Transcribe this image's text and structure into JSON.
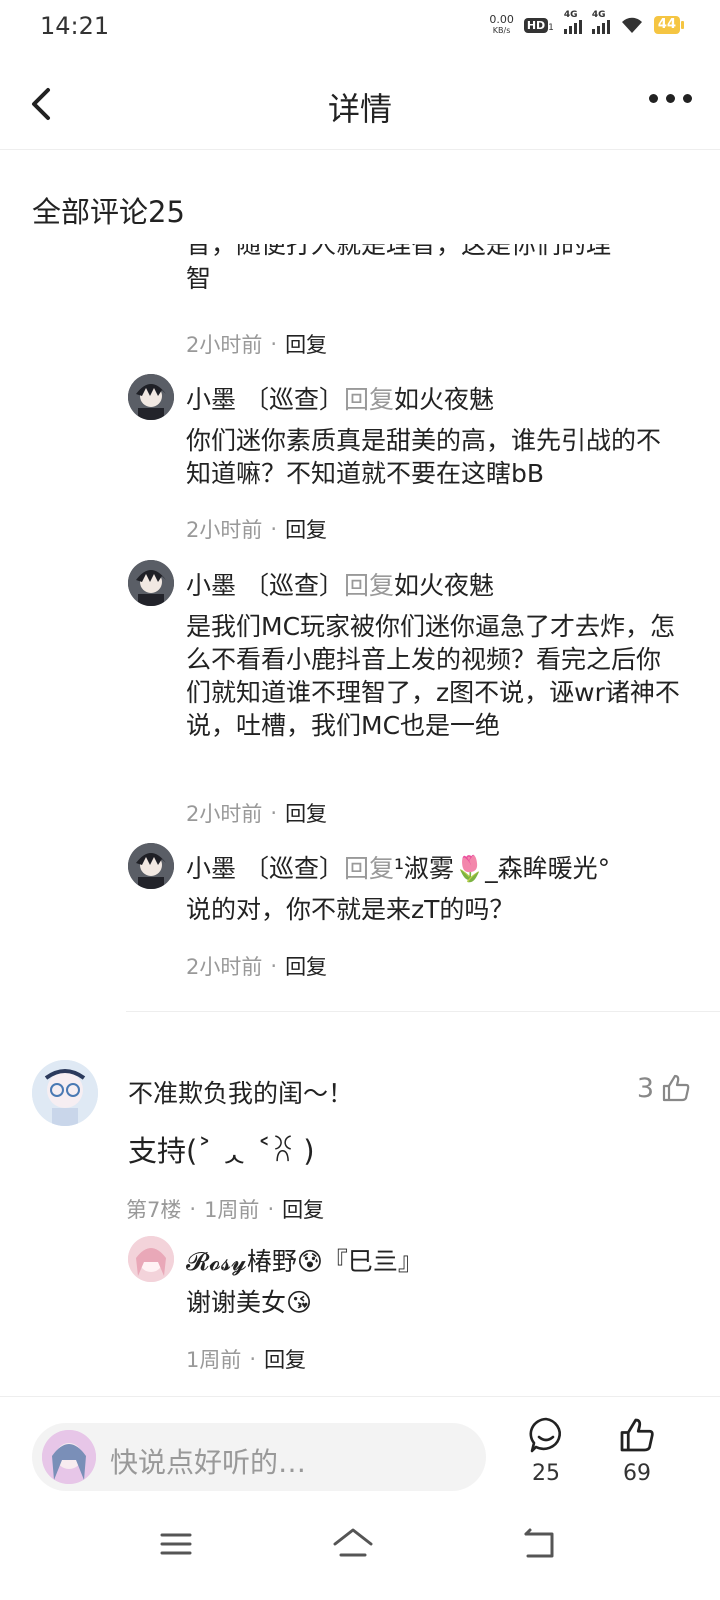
{
  "status": {
    "time": "14:21",
    "speed_value": "0.00",
    "speed_unit": "KB/s",
    "hd_label": "HD",
    "hd_sub": "1",
    "net1": "4G",
    "net2": "4G",
    "battery": "44",
    "battery_color": "#f5c542"
  },
  "header": {
    "title": "详情",
    "back_icon": "chevron-left-icon",
    "more_icon": "more-horizontal-icon"
  },
  "section": {
    "title": "全部评论25"
  },
  "clipped_reply": {
    "partial_line": "音，随便打人就是理智，这是你们的理",
    "last_line": "智",
    "time": "2小时前",
    "reply_label": "回复"
  },
  "replies": [
    {
      "user": "小墨",
      "badge": "〔巡查〕",
      "reply_word": "回复",
      "target": "如火夜魅",
      "text": "你们迷你素质真是甜美的高，谁先引战的不知道嘛？不知道就不要在这瞎bB",
      "time": "2小时前",
      "reply_label": "回复"
    },
    {
      "user": "小墨",
      "badge": "〔巡查〕",
      "reply_word": "回复",
      "target": "如火夜魅",
      "text": "是我们MC玩家被你们迷你逼急了才去炸，怎么不看看小鹿抖音上发的视频？看完之后你们就知道谁不理智了，z图不说，诬wr诸神不说，吐槽，我们MC也是一绝",
      "time": "2小时前",
      "reply_label": "回复"
    },
    {
      "user": "小墨",
      "badge": "〔巡查〕",
      "reply_word": "回复",
      "target": "¹淑雾🌷_森眸暖光°",
      "text": "说的对，你不就是来zT的吗？",
      "time": "2小时前",
      "reply_label": "回复"
    }
  ],
  "comment": {
    "user": "不准欺负我的闺～！",
    "text": "支持(˃ ᆺ ˂ꐦ )",
    "likes": "3",
    "floor": "第7楼",
    "time": "1周前",
    "reply_label": "回复",
    "sub_reply": {
      "user": "𝓡𝓸𝓼𝔂椿野😰『巳亖』",
      "text": "谢谢美女😘",
      "time": "1周前",
      "reply_label": "回复"
    }
  },
  "bottom_bar": {
    "placeholder": "快说点好听的…",
    "comment_count": "25",
    "like_count": "69"
  },
  "nav": {
    "menu_icon": "menu-icon",
    "home_icon": "home-icon",
    "back_icon": "back-icon"
  }
}
